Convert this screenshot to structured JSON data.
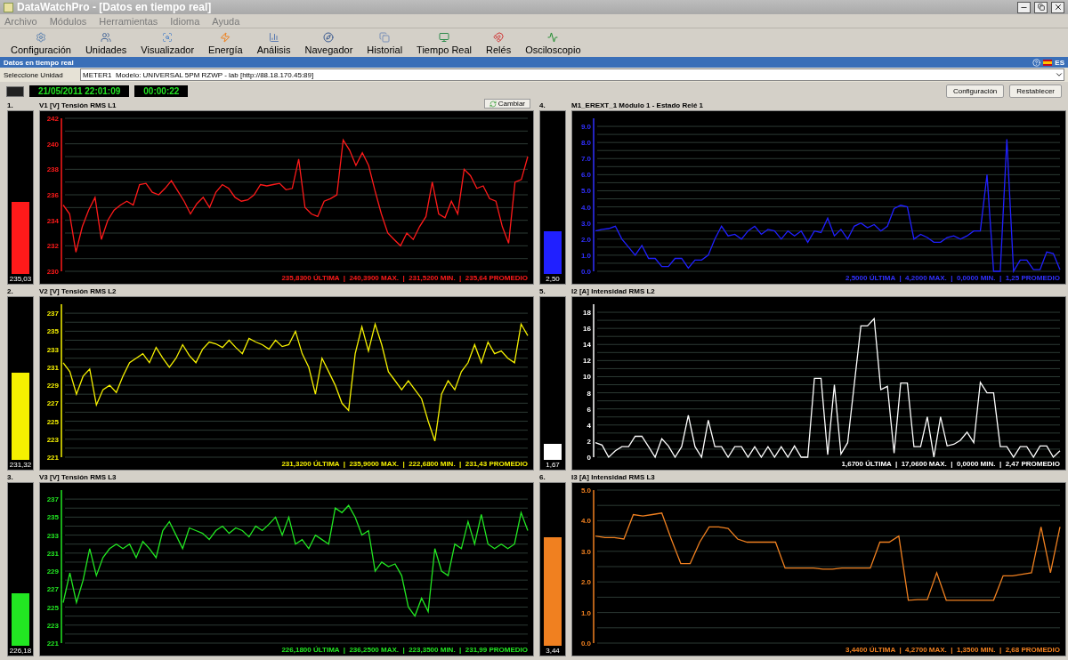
{
  "window": {
    "title": "DataWatchPro - [Datos en tiempo real]"
  },
  "menu": [
    "Archivo",
    "Módulos",
    "Herramientas",
    "Idioma",
    "Ayuda"
  ],
  "toolbar": [
    "Configuración",
    "Unidades",
    "Visualizador",
    "Energía",
    "Análisis",
    "Navegador",
    "Historial",
    "Tiempo Real",
    "Relés",
    "Osciloscopio"
  ],
  "section": {
    "title": "Datos en tiempo real",
    "language": "ES"
  },
  "unit_select": {
    "label": "Seleccione Unidad",
    "value": "METER1  Modelo: UNIVERSAL 5PM RZWP - lab [http://88.18.170.45:89]"
  },
  "clock": {
    "datetime": "21/05/2011 22:01:09",
    "elapsed": "00:00:22"
  },
  "buttons": [
    "Configuración",
    "Restablecer"
  ],
  "panels": [
    {
      "number": "1.",
      "title": "V1 [V] Tensión RMS L1",
      "color": "#ff1a1a",
      "action_button": "Cambiar",
      "meter": {
        "value": "235,03",
        "level": 0.45
      },
      "stats": "235,8300 ÚLTIMA  |  240,3900 MAX.  |  231,5200 MIN.  |  235,64 PROMEDIO",
      "chart_data": {
        "type": "line",
        "grid": true,
        "ylim": [
          230,
          242
        ],
        "yticks": [
          230,
          232,
          234,
          236,
          238,
          240,
          242
        ],
        "series": [
          {
            "color": "#ff1a1a",
            "values": [
              235.2,
              234.5,
              231.5,
              233.5,
              234.8,
              235.8,
              232.5,
              234,
              234.8,
              235.2,
              235.5,
              235.2,
              236.8,
              236.9,
              236.2,
              236,
              236.5,
              237.1,
              236.3,
              235.5,
              234.5,
              235.3,
              235.8,
              235,
              236.2,
              236.8,
              236.5,
              235.8,
              235.5,
              235.6,
              236,
              236.8,
              236.7,
              236.8,
              236.9,
              236.4,
              236.5,
              238.8,
              235,
              234.5,
              234.3,
              235.5,
              235.7,
              236,
              240.3,
              239.5,
              238.3,
              239.3,
              238.3,
              236.3,
              234.5,
              233,
              232.5,
              232,
              233,
              232.5,
              233.5,
              234.3,
              237,
              234.5,
              234.2,
              235.5,
              234.5,
              238,
              237.5,
              236.5,
              236.7,
              235.7,
              235.5,
              233.5,
              232.2,
              237,
              237.2,
              239
            ]
          }
        ]
      }
    },
    {
      "number": "2.",
      "title": "V2 [V] Tensión RMS L2",
      "color": "#f5f000",
      "meter": {
        "value": "231,32",
        "level": 0.55
      },
      "stats": "231,3200 ÚLTIMA  |  235,9000 MAX.  |  222,6800 MIN.  |  231,43 PROMEDIO",
      "chart_data": {
        "type": "line",
        "ylim": [
          221,
          238
        ],
        "yticks": [
          221,
          223,
          225,
          227,
          229,
          231,
          233,
          235,
          237
        ],
        "grid": true,
        "series": [
          {
            "color": "#f5f000",
            "values": [
              231.5,
              230.5,
              228,
              230,
              230.8,
              226.8,
              228.5,
              229,
              228.2,
              230,
              231.5,
              232,
              232.5,
              231.5,
              233.2,
              232,
              231,
              232,
              233.5,
              232.3,
              231.5,
              233,
              233.8,
              233.6,
              233.2,
              234,
              233.2,
              232.5,
              234.2,
              233.8,
              233.5,
              233,
              234,
              233.3,
              233.5,
              235,
              232.5,
              231,
              228,
              232,
              230.5,
              229,
              227,
              226.2,
              232.5,
              235.5,
              232.8,
              235.8,
              233.5,
              230.5,
              229.5,
              228.5,
              229.5,
              228.5,
              227.5,
              225,
              222.8,
              228,
              229.5,
              228.5,
              230.5,
              231.5,
              233.5,
              231.5,
              233.8,
              232.5,
              232.8,
              232,
              231.5,
              235.8,
              234.5
            ]
          }
        ]
      }
    },
    {
      "number": "3.",
      "title": "V3 [V] Tensión RMS L3",
      "color": "#22e622",
      "meter": {
        "value": "226,18",
        "level": 0.33
      },
      "stats": "226,1800 ÚLTIMA  |  236,2500 MAX.  |  223,3500 MIN.  |  231,99 PROMEDIO",
      "chart_data": {
        "type": "line",
        "ylim": [
          221,
          238
        ],
        "yticks": [
          221,
          223,
          225,
          227,
          229,
          231,
          233,
          235,
          237
        ],
        "grid": true,
        "series": [
          {
            "color": "#22e622",
            "values": [
              225.5,
              228.8,
              225.5,
              228,
              231.5,
              228.5,
              230.5,
              231.5,
              232,
              231.5,
              232,
              230.5,
              232.3,
              231.5,
              230.5,
              233.5,
              234.5,
              233,
              231.5,
              233.8,
              233.5,
              233.2,
              232.5,
              233.5,
              234,
              233.2,
              233.8,
              233.5,
              232.8,
              234,
              233.5,
              234.2,
              235,
              233,
              235,
              232,
              232.5,
              231.5,
              233,
              232.5,
              232,
              236,
              235.5,
              236.3,
              235,
              233,
              233.5,
              229,
              230,
              229.5,
              229.8,
              228.5,
              225,
              224,
              226,
              224.5,
              231.5,
              229,
              228.5,
              232,
              231.5,
              234.5,
              232,
              235.3,
              232,
              231.5,
              232,
              231.5,
              232,
              235.5,
              233.5
            ]
          }
        ]
      }
    },
    {
      "number": "4.",
      "title": "M1_EREXT_1 Módulo 1 - Estado Relé 1",
      "color": "#2020ff",
      "meter": {
        "value": "2,50",
        "level": 0.27
      },
      "stats": "2,5000 ÚLTIMA  |  4,2000 MAX.  |  0,0000 MIN.  |  1,25 PROMEDIO",
      "chart_data": {
        "type": "line",
        "ylim": [
          0,
          9.5
        ],
        "yticks": [
          {
            "value": 0,
            "label": "0.0"
          },
          {
            "value": 1,
            "label": "1.0"
          },
          {
            "value": 2,
            "label": "2.0"
          },
          {
            "value": 3,
            "label": "3.0"
          },
          {
            "value": 4,
            "label": "4.0"
          },
          {
            "value": 5,
            "label": "5.0"
          },
          {
            "value": 6,
            "label": "6.0"
          },
          {
            "value": 7,
            "label": "7.0"
          },
          {
            "value": 8,
            "label": "8.0"
          },
          {
            "value": 9,
            "label": "9.0"
          }
        ],
        "grid": true,
        "series": [
          {
            "color": "#2020ff",
            "values": [
              2.5,
              2.6,
              2.65,
              2.8,
              2,
              1.5,
              1,
              1.6,
              0.8,
              0.8,
              0.3,
              0.3,
              0.8,
              0.8,
              0.2,
              0.7,
              0.7,
              1,
              2,
              2.8,
              2.2,
              2.3,
              2,
              2.5,
              2.8,
              2.3,
              2.6,
              2.5,
              2,
              2.5,
              2.2,
              2.5,
              1.8,
              2.5,
              2.4,
              3.3,
              2.2,
              2.6,
              2,
              2.8,
              3,
              2.7,
              2.9,
              2.5,
              2.8,
              3.9,
              4.1,
              4,
              2,
              2.3,
              2.1,
              1.8,
              1.8,
              2.1,
              2.2,
              2,
              2.2,
              2.5,
              2.5,
              6,
              0,
              0,
              8.2,
              0,
              0.7,
              0.7,
              0.1,
              0.1,
              1.2,
              1.1,
              0.1
            ]
          }
        ]
      }
    },
    {
      "number": "5.",
      "title": "I2 [A] Intensidad RMS L2",
      "color": "#ffffff",
      "meter": {
        "value": "1,67",
        "level": 0.1
      },
      "stats": "1,6700 ÚLTIMA  |  17,0600 MAX.  |  0,0000 MIN.  |  2,47 PROMEDIO",
      "chart_data": {
        "type": "line",
        "ylim": [
          0,
          19
        ],
        "yticks": [
          0,
          2,
          4,
          6,
          8,
          10,
          12,
          14,
          16,
          18
        ],
        "grid": true,
        "series": [
          {
            "color": "#ffffff",
            "values": [
              1.8,
              1.5,
              0,
              0.8,
              1.3,
              1.3,
              2.6,
              2.6,
              1.3,
              0,
              2.3,
              1.4,
              0,
              1.3,
              5.2,
              1.3,
              0,
              4.6,
              1.3,
              1.3,
              0,
              1.3,
              1.3,
              0,
              1.3,
              0,
              1.3,
              0,
              1.3,
              0,
              1.4,
              0,
              0,
              9.8,
              9.8,
              0.3,
              9,
              0.4,
              1.8,
              9,
              16.3,
              16.3,
              17.2,
              8.4,
              8.8,
              0.5,
              9.2,
              9.2,
              1.3,
              1.3,
              5,
              0,
              5,
              1.4,
              1.6,
              2.1,
              3.1,
              1.8,
              9.3,
              8,
              8,
              1.3,
              1.3,
              0,
              1.3,
              1.3,
              0,
              1.4,
              1.4,
              0,
              0.8
            ]
          }
        ]
      }
    },
    {
      "number": "6.",
      "title": "I3 [A] Intensidad RMS L3",
      "color": "#f08020",
      "meter": {
        "value": "3,44",
        "level": 0.68
      },
      "stats": "3,4400 ÚLTIMA  |  4,2700 MAX.  |  1,3500 MIN.  |  2,68 PROMEDIO",
      "chart_data": {
        "type": "line",
        "ylim": [
          0,
          5
        ],
        "yticks": [
          {
            "value": 0,
            "label": "0.0"
          },
          {
            "value": 1,
            "label": "1.0"
          },
          {
            "value": 2,
            "label": "2.0"
          },
          {
            "value": 3,
            "label": "3.0"
          },
          {
            "value": 4,
            "label": "4.0"
          },
          {
            "value": 5,
            "label": "5.0"
          }
        ],
        "grid": true,
        "series": [
          {
            "color": "#f08020",
            "values": [
              3.5,
              3.45,
              3.45,
              3.4,
              4.2,
              4.15,
              4.2,
              4.25,
              3.4,
              2.6,
              2.6,
              3.3,
              3.8,
              3.8,
              3.75,
              3.4,
              3.3,
              3.3,
              3.3,
              3.3,
              2.45,
              2.45,
              2.45,
              2.45,
              2.42,
              2.42,
              2.45,
              2.45,
              2.45,
              2.45,
              3.3,
              3.3,
              3.5,
              1.4,
              1.42,
              1.42,
              2.3,
              1.4,
              1.4,
              1.4,
              1.4,
              1.4,
              1.4,
              2.2,
              2.2,
              2.25,
              2.3,
              3.8,
              2.3,
              3.8
            ]
          }
        ]
      }
    }
  ]
}
